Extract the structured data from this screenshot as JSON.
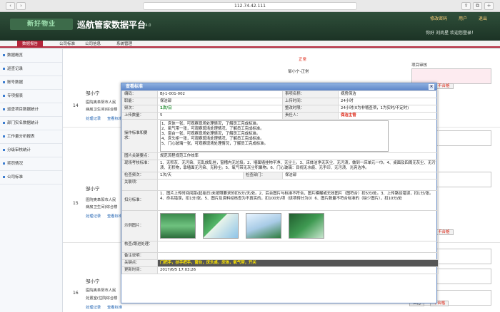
{
  "browser": {
    "url": "112.74.42.111"
  },
  "header": {
    "logo": "新好物业",
    "title": "巡航管家数据平台",
    "version": "V4.0",
    "links": [
      "修改密码",
      "用户",
      "退出"
    ],
    "welcome": "你好 刘尚星 欢迎您登录！"
  },
  "nav": {
    "tabs": [
      "数据报告",
      "公司标准",
      "公司信息",
      "系统管理"
    ]
  },
  "sidebar": {
    "items": [
      "数据概览",
      "巡查记录",
      "账号数据",
      "专项报表",
      "巡查项目数据统计",
      "部门实名数据统计",
      "工作量分析报表",
      "分级审核统计",
      "奖罚情况",
      "公司标准"
    ]
  },
  "rows": [
    {
      "no": "14",
      "name": "邹小宁",
      "line1": "医院奥阜阳市人民",
      "line2": "病房卫生间(综合楼",
      "link1": "处理记录",
      "link2": "查看标准",
      "status": "正常",
      "check": "邹小宁-正常",
      "audit": "项目审核",
      "pass": "合格",
      "fail": "不合格"
    },
    {
      "no": "15",
      "name": "邹小宁",
      "line1": "医院奥阜阳市人民",
      "line2": "病房卫生间(综合楼",
      "link1": "处理记录",
      "link2": "查看标准",
      "status": "",
      "check": "",
      "audit": "",
      "pass": "合格",
      "fail": "不合格"
    },
    {
      "no": "16",
      "name": "邹小宁",
      "line1": "医院奥阜阳市人民",
      "line2": "处置室(住院综合楼",
      "link1": "处理记录",
      "link2": "查看标准",
      "status": "",
      "check": "",
      "audit": "",
      "pass": "合格",
      "fail": "不合格"
    }
  ],
  "modal": {
    "title": "查看标准",
    "code_label": "编码：",
    "code": "BJ-1-001-002",
    "item_label": "事项名称：",
    "item": "病房保洁",
    "post_label": "职能：",
    "post": "保洁部",
    "time_label": "上传时间：",
    "time": "24小时",
    "freq_label": "频次：",
    "freq": "1次/日",
    "rectify_label": "整改时限：",
    "rectify": "24小时(0为非稽查项，1为实时/不定时)",
    "qty_label": "上传数量：",
    "qty": "5",
    "resp_label": "责任人：",
    "resp": "保洁主管",
    "std_label": "操作标准和要求：",
    "std_lines": [
      "1、床体一张，可观察现场处理情况，了解员工完成标准。",
      "2、氧气带一张，可观察现场处理情况，了解员工完成标准。",
      "3、窗台一张，可观察现场处理情况，了解员工完成标准。",
      "4、床头柜一张，可观察现场处理情况，了解员工完成标准。",
      "5、门心玻璃一张，可观察现场处理情况，了解员工完成标准。"
    ],
    "key_label": "图片关键要点：",
    "key": "规范流程规范工作效率",
    "site_label": "现场考核标准：",
    "site": "1、无积灰、无污染、无乱放乱挂，窗槽内无垃圾。2、墙面墙挂物平净、无尘土。3、床体洁净无灰尘、无污渍，做到一床单元一巾。4、桌面及四周无灰尘、无污渍、无积物，靠墙面无污染、无粉尘。5、氧气带无灰尘积聚物。6、门心玻璃：目视无水痕、无手印、无污渍、光亮洁净。",
    "check_label": "检查频次：",
    "check": "1次/天",
    "dept_label": "检查部门：",
    "dept": "保洁部",
    "link_label": "关联项：",
    "link": "",
    "deduct_label": "扣分标准：",
    "deduct": "1、图片上传时间间距(起始日)未按照要求的扣5分/天/处。2、后台图片与标准不符合，图片模糊或无效图片（图符合）扣5分/处。3、上传路径错误，扣1分/张。4、命名错误，扣1分/张。5、图片及资料经核查为不真实的，扣100分/项（该项得分为0）6、图片数量不符合标准的（缺少图片），扣10分/处",
    "sample_label": "示例图片：",
    "review_label": "核查/跟进处理：",
    "review": "",
    "note_label": "备注说明：",
    "note": "",
    "keys_label": "关键点：",
    "keys": "门把手，扶手把手，窗台，床头桌，床体，氧气带，开关",
    "update_label": "更新时间：",
    "update": "2017/6/5 17:03:26"
  }
}
